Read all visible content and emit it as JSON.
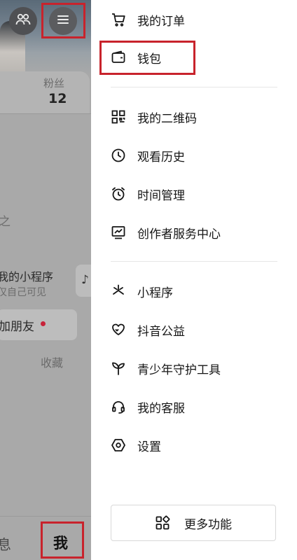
{
  "profile": {
    "fans_label": "粉丝",
    "fans_count": "12",
    "cut_glyph": "之",
    "mini_program_title": "我的小程序",
    "mini_program_subtitle": "仅自己可见",
    "add_friend_label": "加朋友",
    "tab_collect": "收藏"
  },
  "bottom_tabs": {
    "inbox": "息",
    "me": "我"
  },
  "drawer": {
    "section1": [
      {
        "label": "我的订单",
        "icon": "cart-icon"
      },
      {
        "label": "钱包",
        "icon": "wallet-icon"
      }
    ],
    "section2": [
      {
        "label": "我的二维码",
        "icon": "qr-code-icon"
      },
      {
        "label": "观看历史",
        "icon": "clock-icon"
      },
      {
        "label": "时间管理",
        "icon": "alarm-clock-icon"
      },
      {
        "label": "创作者服务中心",
        "icon": "chart-monitor-icon"
      }
    ],
    "section3": [
      {
        "label": "小程序",
        "icon": "mini-program-icon"
      },
      {
        "label": "抖音公益",
        "icon": "heart-hands-icon"
      },
      {
        "label": "青少年守护工具",
        "icon": "sprout-icon"
      },
      {
        "label": "我的客服",
        "icon": "headset-icon"
      },
      {
        "label": "设置",
        "icon": "settings-icon"
      }
    ],
    "more_button": "更多功能"
  },
  "colors": {
    "highlight_box": "#c8232c",
    "overlay": "#a9a9a9"
  }
}
